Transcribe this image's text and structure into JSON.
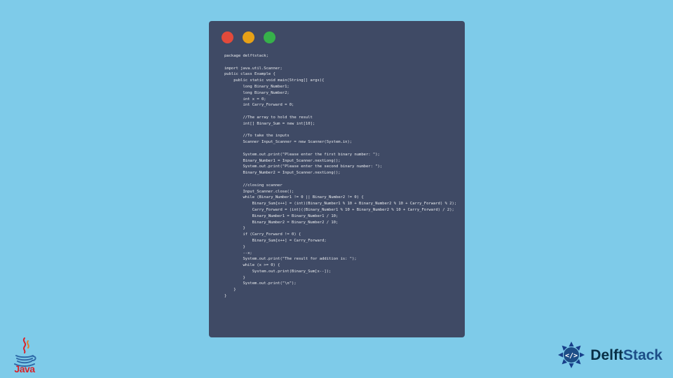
{
  "window": {
    "colors": {
      "red": "#e24a3b",
      "yellow": "#e7a117",
      "green": "#36b14a",
      "bg": "#3f4a65"
    }
  },
  "code": {
    "text": "package delftstack;\n\nimport java.util.Scanner;\npublic class Example {\n    public static void main(String[] args){\n        long Binary_Number1;\n        long Binary_Number2;\n        int x = 0;\n        int Carry_Forward = 0;\n\n        //The array to hold the result\n        int[] Binary_Sum = new int[10];\n\n        //To take the inputs\n        Scanner Input_Scanner = new Scanner(System.in);\n\n        System.out.print(\"Please enter the first binary number: \");\n        Binary_Number1 = Input_Scanner.nextLong();\n        System.out.print(\"Please enter the second binary number: \");\n        Binary_Number2 = Input_Scanner.nextLong();\n\n        //closing scanner\n        Input_Scanner.close();\n        while (Binary_Number1 != 0 || Binary_Number2 != 0) {\n            Binary_Sum[x++] = (int)(Binary_Number1 % 10 + Binary_Number2 % 10 + Carry_Forward) % 2);\n            Carry_Forward = (int)((Binary_Number1 % 10 + Binary_Number2 % 10 + Carry_Forward) / 2);\n            Binary_Number1 = Binary_Number1 / 10;\n            Binary_Number2 = Binary_Number2 / 10;\n        }\n        if (Carry_Forward != 0) {\n            Binary_Sum[x++] = Carry_Forward;\n        }\n        --x;\n        System.out.print(\"The result for addition is: \");\n        while (x >= 0) {\n            System.out.print(Binary_Sum[x--]);\n        }\n        System.out.print(\"\\n\");\n    }\n}"
  },
  "java_logo": {
    "label": "Java"
  },
  "delftstack": {
    "word1": "Delft",
    "word2": "Stack"
  },
  "page_bg": "#7ecbe9"
}
